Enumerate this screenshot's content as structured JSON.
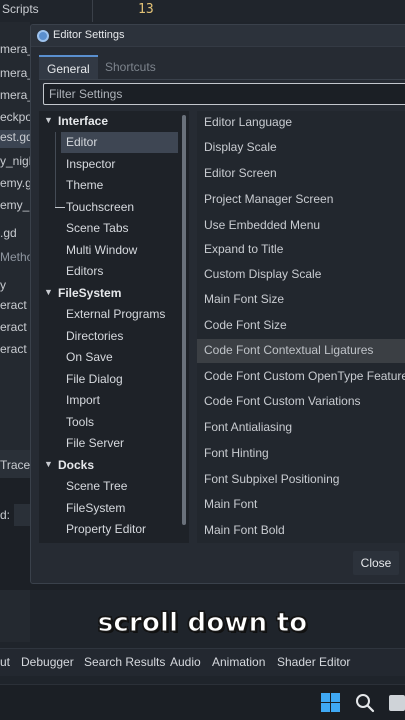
{
  "background": {
    "scripts_header": "Scripts",
    "line_number": "13",
    "file_list": [
      "mera_",
      "mera_",
      "mera_",
      "eckpo",
      "est.gd",
      "y_nigh",
      "emy.g",
      "emy_",
      ".gd"
    ],
    "methods_header": "Metho",
    "method_list": [
      "y",
      "eract",
      "eract",
      "eract"
    ],
    "trace_label": "Trace",
    "d_label": "d:"
  },
  "dialog": {
    "title": "Editor Settings",
    "tabs": [
      {
        "label": "General",
        "active": true
      },
      {
        "label": "Shortcuts",
        "active": false
      }
    ],
    "filter_placeholder": "Filter Settings",
    "tree": [
      {
        "label": "Interface",
        "type": "category"
      },
      {
        "label": "Editor",
        "type": "sub",
        "selected": true
      },
      {
        "label": "Inspector",
        "type": "sub"
      },
      {
        "label": "Theme",
        "type": "sub"
      },
      {
        "label": "Touchscreen",
        "type": "sub"
      },
      {
        "label": "Scene Tabs",
        "type": "sub"
      },
      {
        "label": "Multi Window",
        "type": "sub"
      },
      {
        "label": "Editors",
        "type": "sub"
      },
      {
        "label": "FileSystem",
        "type": "category"
      },
      {
        "label": "External Programs",
        "type": "sub"
      },
      {
        "label": "Directories",
        "type": "sub"
      },
      {
        "label": "On Save",
        "type": "sub"
      },
      {
        "label": "File Dialog",
        "type": "sub"
      },
      {
        "label": "Import",
        "type": "sub"
      },
      {
        "label": "Tools",
        "type": "sub"
      },
      {
        "label": "File Server",
        "type": "sub"
      },
      {
        "label": "Docks",
        "type": "category"
      },
      {
        "label": "Scene Tree",
        "type": "sub"
      },
      {
        "label": "FileSystem",
        "type": "sub"
      },
      {
        "label": "Property Editor",
        "type": "sub"
      }
    ],
    "properties": [
      "Editor Language",
      "Display Scale",
      "Editor Screen",
      "Project Manager Screen",
      "Use Embedded Menu",
      "Expand to Title",
      "Custom Display Scale",
      "Main Font Size",
      "Code Font Size",
      "Code Font Contextual Ligatures",
      "Code Font Custom OpenType Features",
      "Code Font Custom Variations",
      "Font Antialiasing",
      "Font Hinting",
      "Font Subpixel Positioning",
      "Main Font",
      "Main Font Bold"
    ],
    "highlighted_property": "Code Font Contextual Ligatures",
    "close_label": "Close"
  },
  "caption": "scroll down to",
  "bottom_tabs": [
    "ut",
    "Debugger",
    "Search Results",
    "Audio",
    "Animation",
    "Shader Editor"
  ],
  "colors": {
    "accent": "#5a8fcf",
    "windows_logo": "#3fa9f5"
  }
}
